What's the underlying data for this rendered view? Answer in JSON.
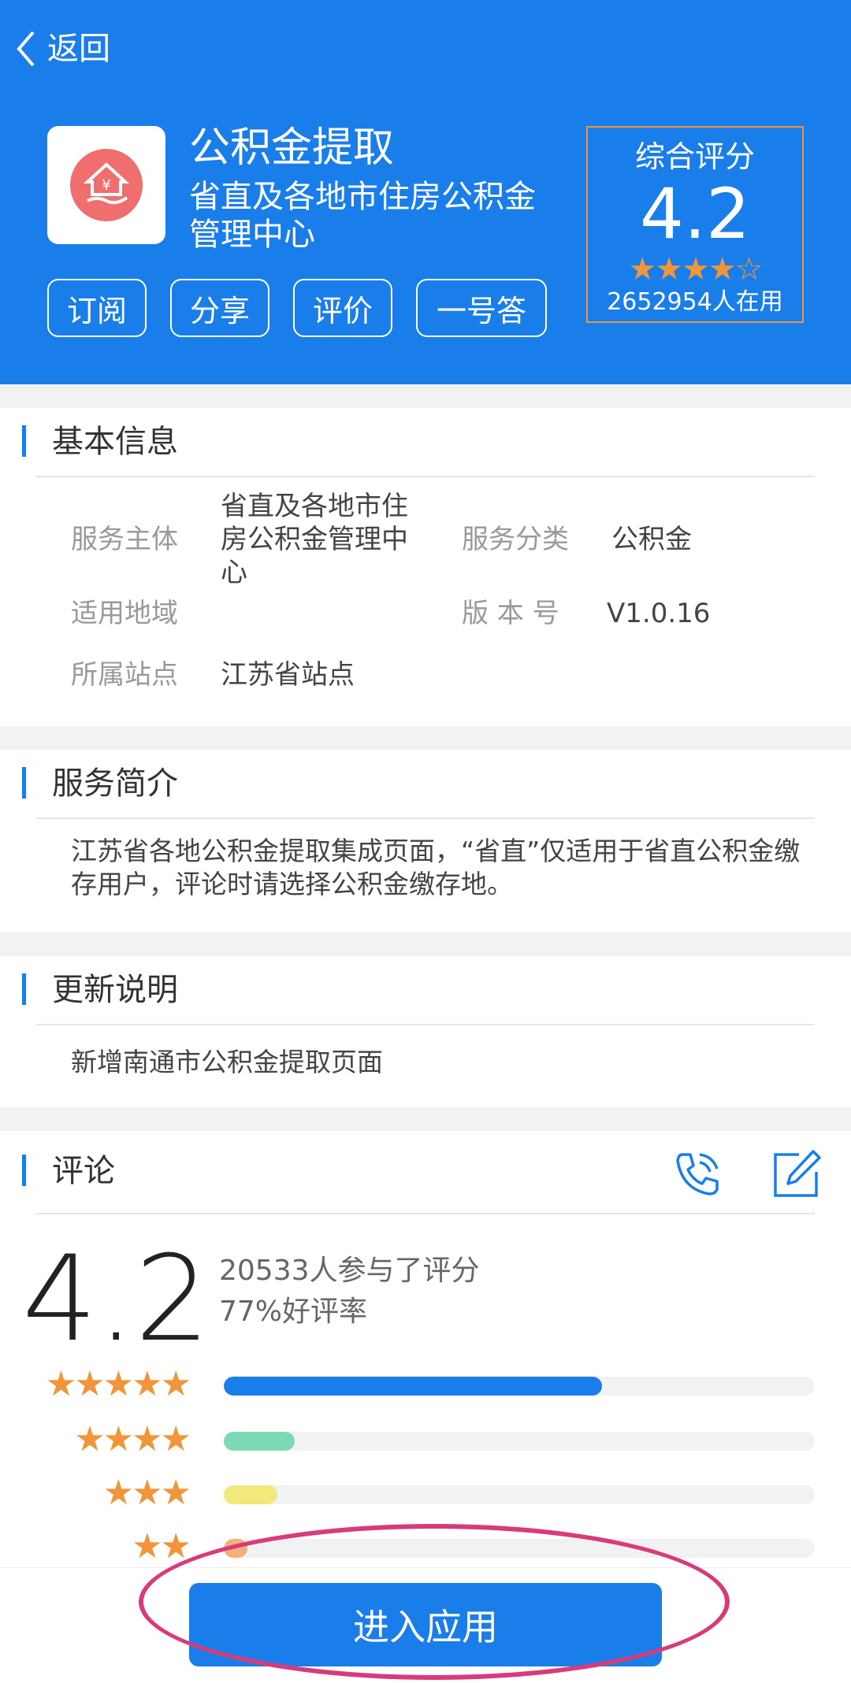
{
  "header": {
    "back_label": "返回",
    "app_name": "公积金提取",
    "app_org": "省直及各地市住房公积金管理中心",
    "buttons": [
      "订阅",
      "分享",
      "评价",
      "一号答"
    ],
    "score_label": "综合评分",
    "score_value": "4.2",
    "score_stars": "★★★★☆",
    "users": "2652954人在用"
  },
  "basic_info": {
    "title": "基本信息",
    "service_subject_label": "服务主体",
    "service_subject_value": "省直及各地市住房公积金管理中心",
    "service_category_label": "服务分类",
    "service_category_value": "公积金",
    "region_label": "适用地域",
    "region_value": "",
    "version_label": "版 本 号",
    "version_value": "V1.0.16",
    "site_label": "所属站点",
    "site_value": "江苏省站点"
  },
  "intro": {
    "title": "服务简介",
    "text": "江苏省各地公积金提取集成页面，“省直”仅适用于省直公积金缴存用户，评论时请选择公积金缴存地。"
  },
  "update": {
    "title": "更新说明",
    "text": "新增南通市公积金提取页面"
  },
  "comments": {
    "title": "评论",
    "rating": "4.2",
    "participants": "20533人参与了评分",
    "good_rate": "77%好评率",
    "distribution": [
      {
        "stars": "★★★★★",
        "fraction": 0.64,
        "color": "#1a7eea"
      },
      {
        "stars": "★★★★",
        "fraction": 0.12,
        "color": "#7dd8b4"
      },
      {
        "stars": "★★★",
        "fraction": 0.09,
        "color": "#f2e97c"
      },
      {
        "stars": "★★",
        "fraction": 0.04,
        "color": "#f4b07a"
      }
    ]
  },
  "bottom": {
    "enter_label": "进入应用"
  }
}
